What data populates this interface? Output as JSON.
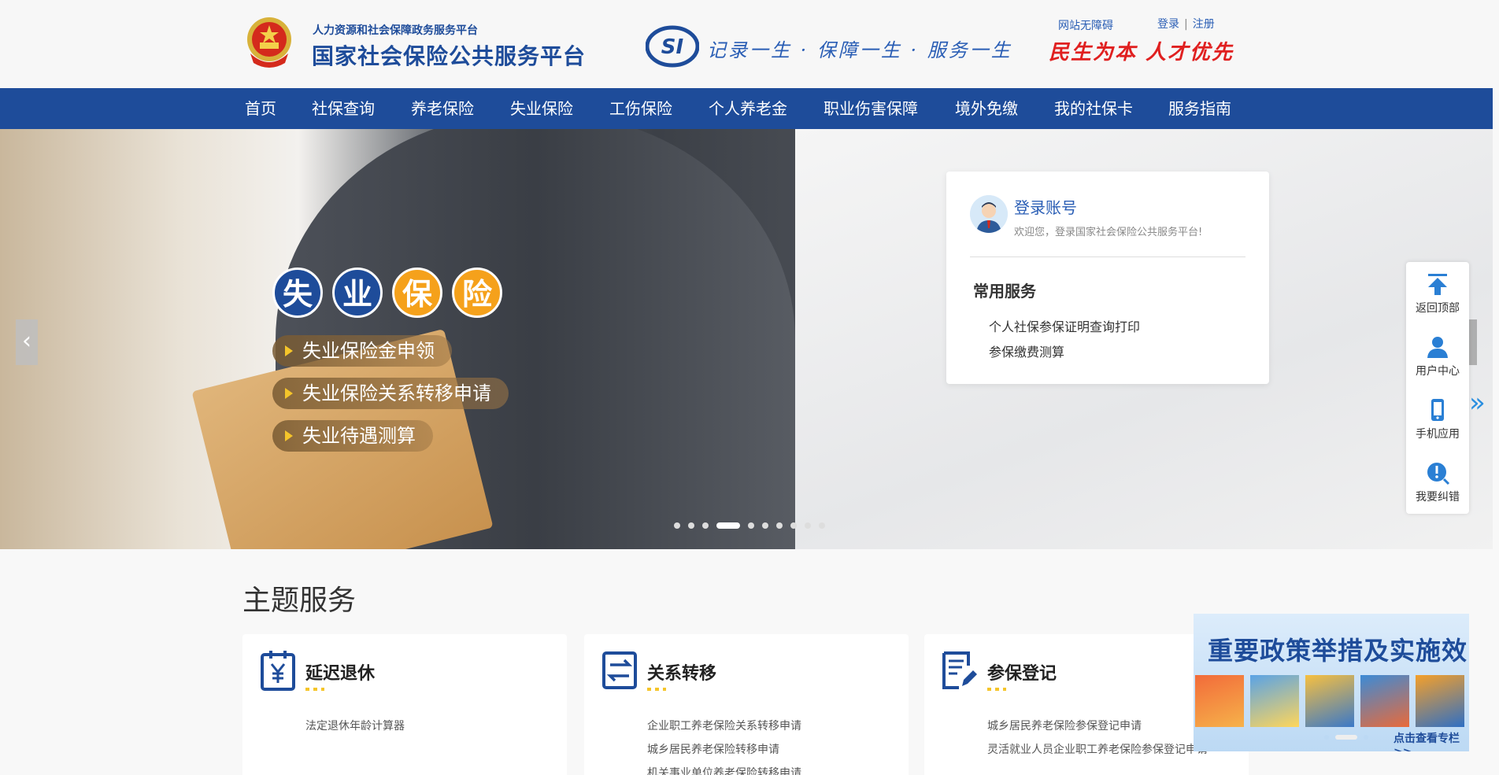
{
  "header": {
    "sub_title": "人力资源和社会保障政务服务平台",
    "title": "国家社会保险公共服务平台",
    "si_logo": "SI",
    "slogan": "记录一生 · 保障一生 · 服务一生",
    "accessible": "网站无障碍",
    "login": "登录",
    "separator": "|",
    "register": "注册",
    "motto": "民生为本 人才优先"
  },
  "nav": {
    "items": [
      "首页",
      "社保查询",
      "养老保险",
      "失业保险",
      "工伤保险",
      "个人养老金",
      "职业伤害保障",
      "境外免缴",
      "我的社保卡",
      "服务指南"
    ]
  },
  "banner": {
    "circles": [
      "失",
      "业",
      "保",
      "险"
    ],
    "pills": [
      "失业保险金申领",
      "失业保险关系转移申请",
      "失业待遇测算"
    ],
    "prev_icon": "‹",
    "slide_count": 10,
    "active_slide": 4
  },
  "login_card": {
    "title": "登录账号",
    "desc": "欢迎您，登录国家社会保险公共服务平台!",
    "common_title": "常用服务",
    "common_items": [
      "个人社保参保证明查询打印",
      "参保缴费测算"
    ]
  },
  "float_bar": {
    "items": [
      {
        "label": "返回顶部",
        "icon": "arrow-up-icon"
      },
      {
        "label": "用户中心",
        "icon": "user-icon"
      },
      {
        "label": "手机应用",
        "icon": "phone-icon"
      },
      {
        "label": "我要纠错",
        "icon": "alert-icon"
      }
    ],
    "expand_icon": "»"
  },
  "theme": {
    "title": "主题服务",
    "cards": [
      {
        "title": "延迟退休",
        "icon": "yen-clipboard-icon",
        "links": [
          "法定退休年龄计算器"
        ]
      },
      {
        "title": "关系转移",
        "icon": "transfer-icon",
        "links": [
          "企业职工养老保险关系转移申请",
          "城乡居民养老保险转移申请",
          "机关事业单位养老保险转移申请"
        ]
      },
      {
        "title": "参保登记",
        "icon": "document-edit-icon",
        "links": [
          "城乡居民养老保险参保登记申请",
          "灵活就业人员企业职工养老保险参保登记申请"
        ]
      }
    ]
  },
  "policy": {
    "title": "重要政策举措及实施效果",
    "more": "点击查看专栏 >>"
  },
  "colors": {
    "brand_blue": "#1e4c9a",
    "accent_orange": "#f5a11b",
    "motto_red": "#e02020"
  }
}
